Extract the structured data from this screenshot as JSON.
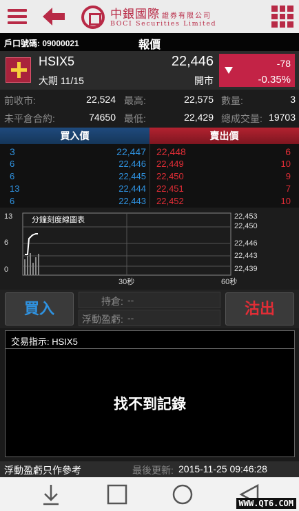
{
  "colors": {
    "brand": "#b82a46",
    "bid": "#2f92e0",
    "ask": "#e22d36",
    "down": "#c32346"
  },
  "header": {
    "logo_zh": "中銀國際",
    "logo_zh_small": "證券有限公司",
    "logo_en": "BOCI Securities Limited"
  },
  "titlebar": {
    "account": "戶口號碼: 09000021",
    "title": "報價"
  },
  "quote": {
    "symbol": "HSIX5",
    "contract": "大期 11/15",
    "last": "22,446",
    "status": "開市",
    "change": "-78",
    "change_pct": "-0.35%"
  },
  "stats": {
    "prev_close_label": "前收市:",
    "prev_close": "22,524",
    "high_label": "最高:",
    "high": "22,575",
    "qty_label": "數量:",
    "qty": "3",
    "open_int_label": "未平倉合約:",
    "open_int": "74650",
    "low_label": "最低:",
    "low": "22,429",
    "volume_label": "總成交量:",
    "volume": "19703"
  },
  "depth": {
    "bid_header": "買入價",
    "ask_header": "賣出價",
    "rows": [
      {
        "bid_qty": "3",
        "bid": "22,447",
        "ask": "22,448",
        "ask_qty": "6"
      },
      {
        "bid_qty": "6",
        "bid": "22,446",
        "ask": "22,449",
        "ask_qty": "10"
      },
      {
        "bid_qty": "6",
        "bid": "22,445",
        "ask": "22,450",
        "ask_qty": "9"
      },
      {
        "bid_qty": "13",
        "bid": "22,444",
        "ask": "22,451",
        "ask_qty": "7"
      },
      {
        "bid_qty": "6",
        "bid": "22,443",
        "ask": "22,452",
        "ask_qty": "10"
      }
    ]
  },
  "chart": {
    "title": "分鐘刻度線圖表",
    "vol_ticks": [
      "13",
      "6",
      "0"
    ],
    "price_ticks": [
      "22,453",
      "22,450",
      "22,446",
      "22,443",
      "22,439"
    ],
    "x_ticks": [
      "30秒",
      "60秒"
    ]
  },
  "actions": {
    "buy": "買入",
    "sell": "沽出",
    "holding_label": "持倉:",
    "holding_value": "--",
    "pnl_label": "浮動盈虧:",
    "pnl_value": "--"
  },
  "orders": {
    "title": "交易指示: HSIX5",
    "empty": "找不到記錄"
  },
  "footer": {
    "note": "浮動盈虧只作參考",
    "updated_label": "最後更新:",
    "updated": "2015-11-25 09:46:28"
  },
  "watermark": "WWW.QT6.COM"
}
